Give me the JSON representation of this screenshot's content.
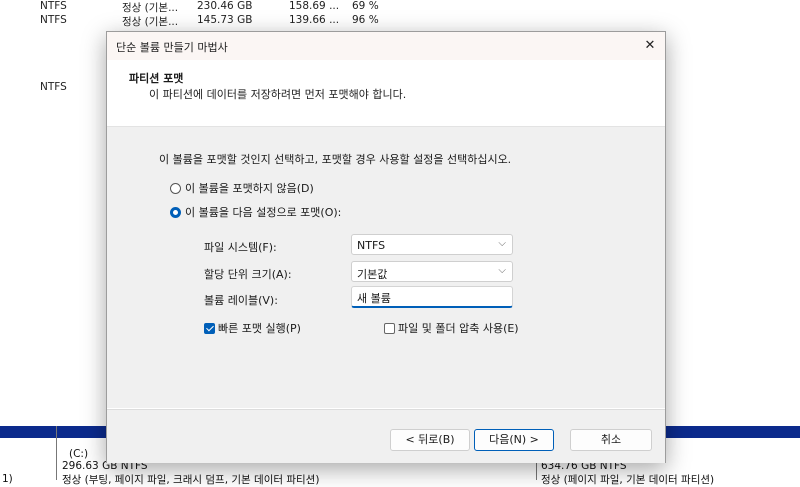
{
  "background": {
    "volumes": [
      {
        "fs": "NTFS",
        "status": "정상 (기본...",
        "capacity": "230.46 GB",
        "free": "158.69 ...",
        "pct": "69 %"
      },
      {
        "fs": "NTFS",
        "status": "정상 (기본...",
        "capacity": "145.73 GB",
        "free": "139.66 ...",
        "pct": "96 %"
      },
      {
        "fs": "NTFS"
      }
    ],
    "disk_left_label": "1)",
    "partition_c": {
      "label": "(C:)",
      "size": "296.63 GB NTFS",
      "status": "정상 (부팅, 페이지 파일, 크래시 덤프, 기본 데이터 파티션)"
    },
    "partition_right": {
      "size": "634.76 GB NTFS",
      "status": "정상 (페이지 파일, 기본 데이터 파티션)"
    }
  },
  "dialog": {
    "title": "단순 볼륨 만들기 마법사",
    "close_glyph": "✕",
    "header_title": "파티션 포맷",
    "header_subtitle": "이 파티션에 데이터를 저장하려면 먼저 포맷해야 합니다.",
    "instruction": "이 볼륨을 포맷할 것인지 선택하고, 포맷할 경우 사용할 설정을 선택하십시오.",
    "radio_no_format": "이 볼륨을 포맷하지 않음(D)",
    "radio_format": "이 볼륨을 다음 설정으로 포맷(O):",
    "selected_option": "format",
    "file_system_label": "파일 시스템(F):",
    "file_system_value": "NTFS",
    "alloc_unit_label": "할당 단위 크기(A):",
    "alloc_unit_value": "기본값",
    "volume_label_label": "볼륨 레이블(V):",
    "volume_label_value": "새 볼륨",
    "quick_format_label": "빠른 포맷 실행(P)",
    "quick_format_checked": true,
    "compression_label": "파일 및 폴더 압축 사용(E)",
    "compression_checked": false,
    "back_button": "< 뒤로(B)",
    "next_button": "다음(N) >",
    "cancel_button": "취소",
    "accent_color": "#005fb8"
  }
}
